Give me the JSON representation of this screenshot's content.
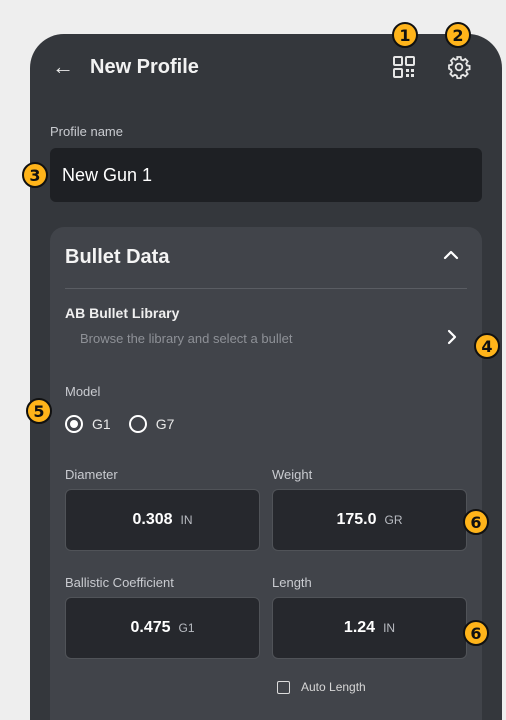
{
  "header": {
    "back_icon": "arrow-left-icon",
    "title": "New Profile",
    "qr_icon": "qr-code-icon",
    "settings_icon": "gear-icon"
  },
  "profile": {
    "label": "Profile name",
    "value": "New Gun 1"
  },
  "bullet_card": {
    "title": "Bullet Data",
    "library_title": "AB Bullet Library",
    "library_subtitle": "Browse the library and select a bullet",
    "model_label": "Model",
    "models": [
      {
        "label": "G1",
        "selected": true
      },
      {
        "label": "G7",
        "selected": false
      }
    ],
    "fields": [
      {
        "label": "Diameter",
        "value": "0.308",
        "unit": "IN"
      },
      {
        "label": "Weight",
        "value": "175.0",
        "unit": "GR"
      },
      {
        "label": "Ballistic Coefficient",
        "value": "0.475",
        "unit": "G1"
      },
      {
        "label": "Length",
        "value": "1.24",
        "unit": "IN"
      }
    ],
    "auto_length_label": "Auto Length",
    "auto_length_checked": false
  },
  "annotations": [
    "1",
    "2",
    "3",
    "4",
    "5",
    "6",
    "6"
  ],
  "colors": {
    "screen_bg": "#34373c",
    "card_bg": "#41444a",
    "input_bg": "#1e2024",
    "badge": "#ffb41a"
  }
}
